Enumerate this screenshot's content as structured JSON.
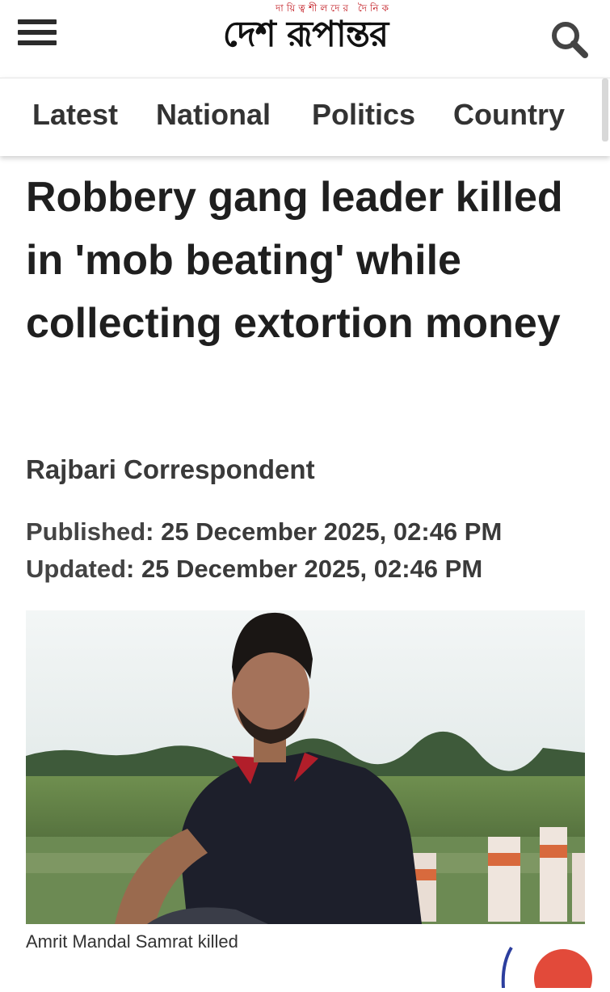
{
  "header": {
    "logo_tagline": "দায়িত্বশীলদের দৈনিক",
    "logo_name": "দেশ রূপান্তর",
    "brand_color": "#c0141b"
  },
  "nav": {
    "items": [
      {
        "label": "Latest"
      },
      {
        "label": "National"
      },
      {
        "label": "Politics"
      },
      {
        "label": "Country"
      }
    ]
  },
  "article": {
    "title": "Robbery gang leader killed in 'mob beating' while collecting extortion money",
    "author": "Rajbari Correspondent",
    "published_label": "Published",
    "published_value": "25 December 2025, 02:46 PM",
    "updated_label": "Updated",
    "updated_value": "25 December 2025, 02:46 PM",
    "image_caption": "Amrit Mandal Samrat killed"
  },
  "icons": {
    "menu": "hamburger-menu-icon",
    "search": "search-icon"
  }
}
